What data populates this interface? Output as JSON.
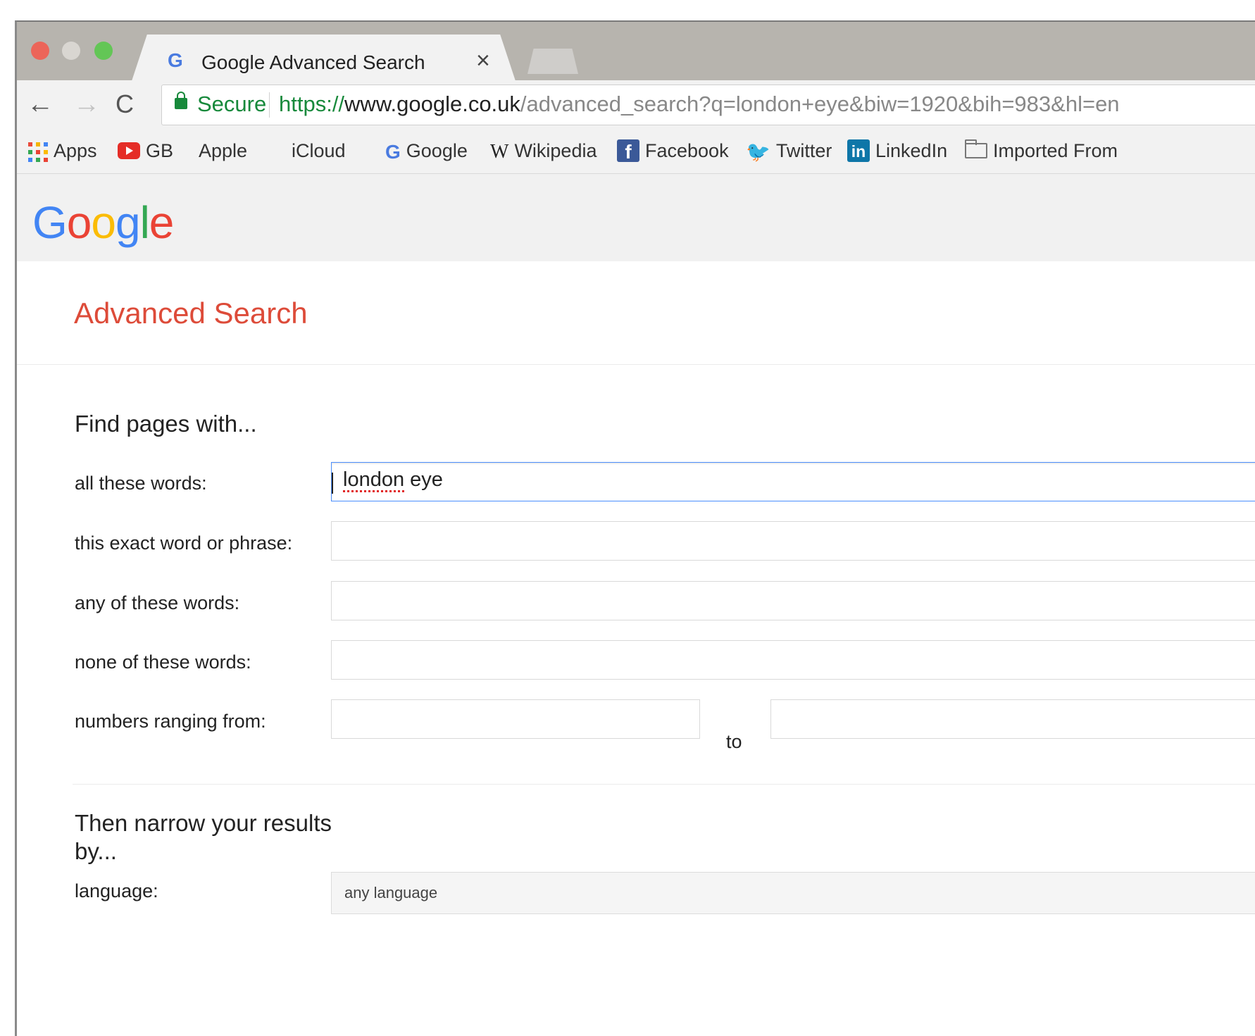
{
  "browser": {
    "tab_title": "Google Advanced Search",
    "tab_close": "×",
    "tab_favicon": "G",
    "secure_label": "Secure",
    "url_scheme": "https://",
    "url_host": "www.google.co.uk",
    "url_path": "/advanced_search?q=london+eye&biw=1920&bih=983&hl=en",
    "nav": {
      "back_icon": "←",
      "forward_icon": "→",
      "reload_icon": "C"
    }
  },
  "bookmarks": [
    {
      "label": "Apps",
      "icon": "apps-grid-icon"
    },
    {
      "label": "GB",
      "icon": "youtube-icon"
    },
    {
      "label": "Apple",
      "icon": "apple-icon"
    },
    {
      "label": "iCloud",
      "icon": "apple-icon"
    },
    {
      "label": "Google",
      "icon": "google-g-icon"
    },
    {
      "label": "Wikipedia",
      "icon": "wikipedia-w-icon"
    },
    {
      "label": "Facebook",
      "icon": "facebook-icon"
    },
    {
      "label": "Twitter",
      "icon": "twitter-bird-icon"
    },
    {
      "label": "LinkedIn",
      "icon": "linkedin-icon"
    },
    {
      "label": "Imported From",
      "icon": "folder-icon"
    }
  ],
  "bookmark_glyphs": {
    "apple": "",
    "google": "G",
    "wikipedia": "W",
    "facebook": "f",
    "twitter": "🐦",
    "linkedin": "in"
  },
  "logo": {
    "l1": "G",
    "l2": "o",
    "l3": "o",
    "l4": "g",
    "l5": "l",
    "l6": "e"
  },
  "page": {
    "title": "Advanced Search",
    "find_heading": "Find pages with...",
    "fields": {
      "all_words_label": "all these words:",
      "all_words_value_misspelled": "london",
      "all_words_value_rest": " eye",
      "exact_phrase_label": "this exact word or phrase:",
      "any_words_label": "any of these words:",
      "none_words_label": "none of these words:",
      "numbers_label": "numbers ranging from:",
      "to_label": "to"
    },
    "narrow_heading": "Then narrow your results by...",
    "language_label": "language:",
    "language_value": "any language"
  },
  "colors": {
    "page_title": "#dd4b39",
    "secure_green": "#17893b",
    "focus_blue": "#4d90fe"
  }
}
